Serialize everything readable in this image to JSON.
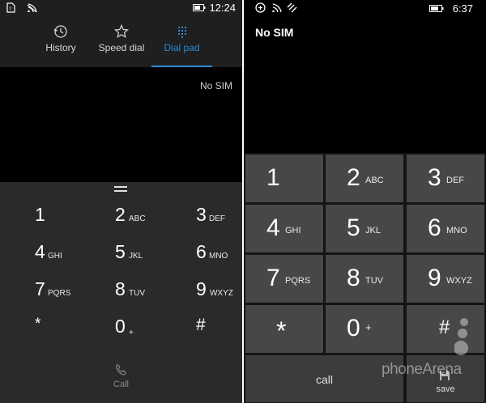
{
  "left": {
    "status": {
      "time": "12:24",
      "icons": [
        "sim-icon",
        "wifi-icon",
        "battery-icon"
      ]
    },
    "tabs": [
      {
        "label": "History",
        "icon": "history-icon",
        "active": false
      },
      {
        "label": "Speed dial",
        "icon": "star-icon",
        "active": false
      },
      {
        "label": "Dial pad",
        "icon": "dialpad-icon",
        "active": true
      }
    ],
    "display": {
      "no_sim": "No SIM"
    },
    "keys": [
      {
        "digit": "1",
        "sub": ""
      },
      {
        "digit": "2",
        "sub": "ABC"
      },
      {
        "digit": "3",
        "sub": "DEF"
      },
      {
        "digit": "4",
        "sub": "GHI"
      },
      {
        "digit": "5",
        "sub": "JKL"
      },
      {
        "digit": "6",
        "sub": "MNO"
      },
      {
        "digit": "7",
        "sub": "PQRS"
      },
      {
        "digit": "8",
        "sub": "TUV"
      },
      {
        "digit": "9",
        "sub": "WXYZ"
      },
      {
        "digit": "*",
        "sub": ""
      },
      {
        "digit": "0",
        "sub": "+"
      },
      {
        "digit": "#",
        "sub": ""
      }
    ],
    "call_label": "Call",
    "accent": "#2a8ad4"
  },
  "right": {
    "status": {
      "time": "6:37",
      "icons": [
        "sim-icon",
        "wifi-icon",
        "data-icon",
        "battery-icon"
      ]
    },
    "no_sim": "No SIM",
    "keys": [
      {
        "digit": "1",
        "sub": ""
      },
      {
        "digit": "2",
        "sub": "ABC"
      },
      {
        "digit": "3",
        "sub": "DEF"
      },
      {
        "digit": "4",
        "sub": "GHI"
      },
      {
        "digit": "5",
        "sub": "JKL"
      },
      {
        "digit": "6",
        "sub": "MNO"
      },
      {
        "digit": "7",
        "sub": "PQRS"
      },
      {
        "digit": "8",
        "sub": "TUV"
      },
      {
        "digit": "9",
        "sub": "WXYZ"
      },
      {
        "digit": "*",
        "sub": ""
      },
      {
        "digit": "0",
        "sub": "+"
      },
      {
        "digit": "#",
        "sub": ""
      }
    ],
    "call_label": "call",
    "save_label": "save"
  },
  "watermark": "phoneArena"
}
